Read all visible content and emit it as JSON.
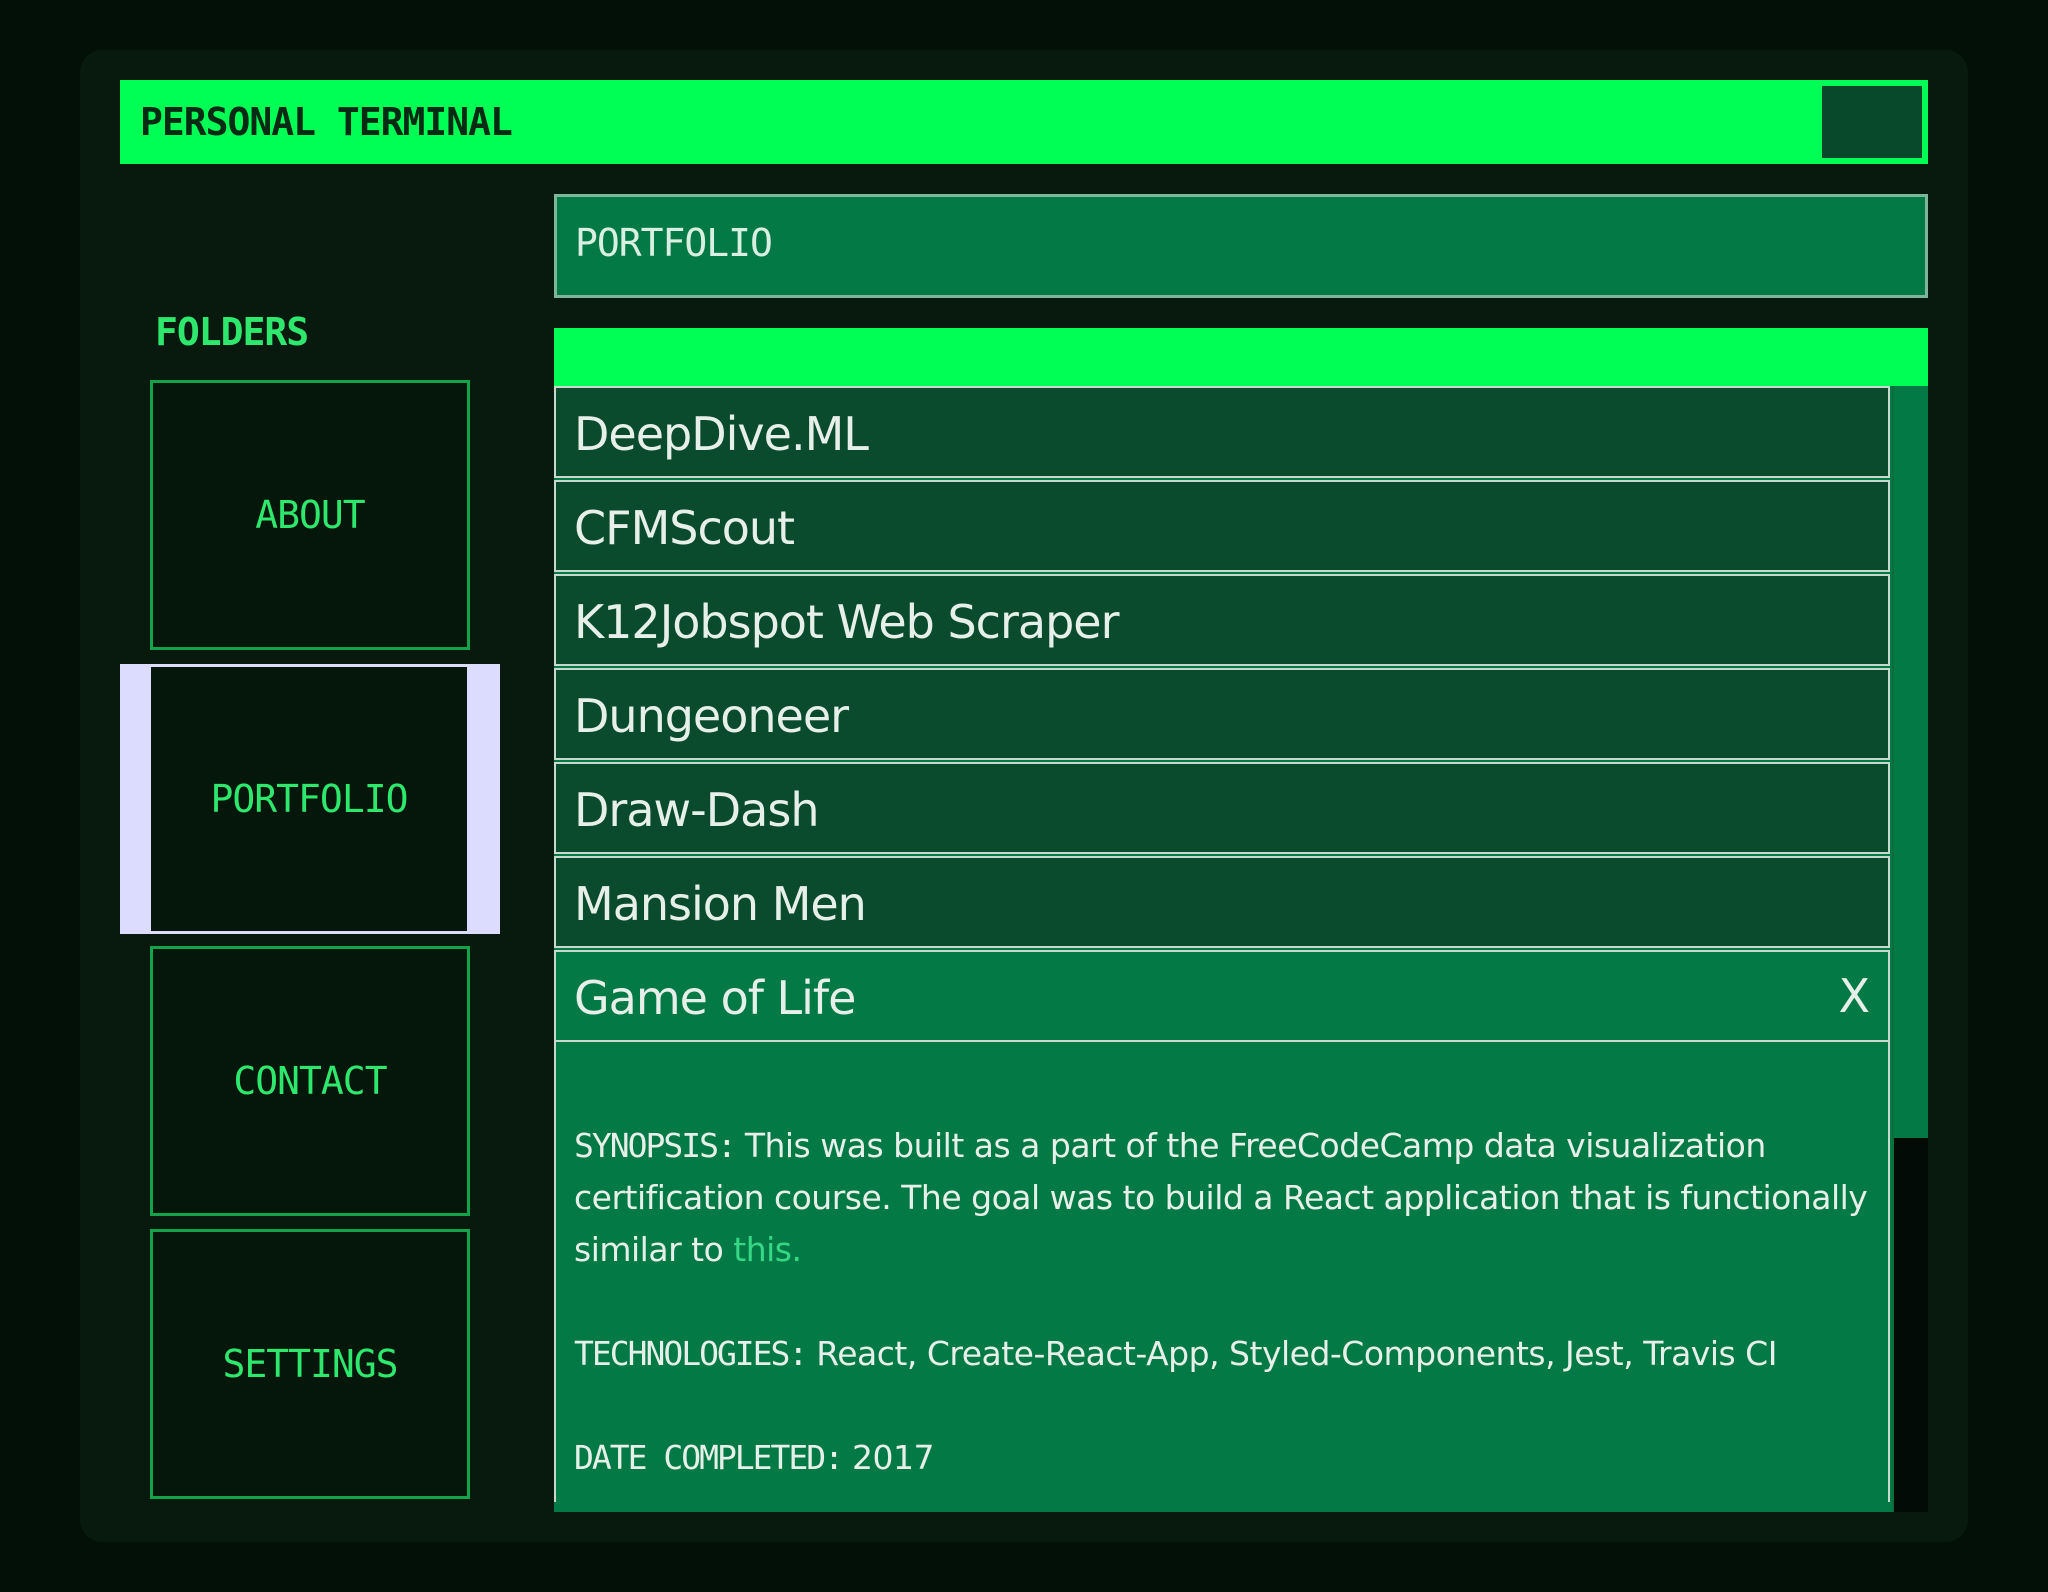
{
  "window": {
    "title": "PERSONAL TERMINAL"
  },
  "sidebar": {
    "label": "FOLDERS",
    "items": [
      {
        "label": "ABOUT"
      },
      {
        "label": "PORTFOLIO",
        "selected": true
      },
      {
        "label": "CONTACT"
      },
      {
        "label": "SETTINGS"
      }
    ]
  },
  "path": {
    "current": "PORTFOLIO"
  },
  "projects": {
    "items": [
      {
        "name": "DeepDive.ML"
      },
      {
        "name": "CFMScout"
      },
      {
        "name": "K12Jobspot Web Scraper"
      },
      {
        "name": "Dungeoneer"
      },
      {
        "name": "Draw-Dash"
      },
      {
        "name": "Mansion Men"
      },
      {
        "name": "Game of Life",
        "expanded": true
      }
    ],
    "close_label": "X",
    "detail": {
      "synopsis_key": "SYNOPSIS:",
      "synopsis_text": "This was built as a part of the FreeCodeCamp data visualization certification course. The goal was to build a React application that is functionally similar to",
      "synopsis_link": "this.",
      "technologies_key": "TECHNOLOGIES:",
      "technologies_text": "React, Create-React-App, Styled-Components, Jest, Travis CI",
      "date_key": "DATE COMPLETED:",
      "date_text": "2017"
    }
  },
  "colors": {
    "accent": "#00ff55",
    "panel": "#037a45",
    "row": "#0b4b2d",
    "selected_highlight": "#dcdcff",
    "link": "#36d886"
  }
}
